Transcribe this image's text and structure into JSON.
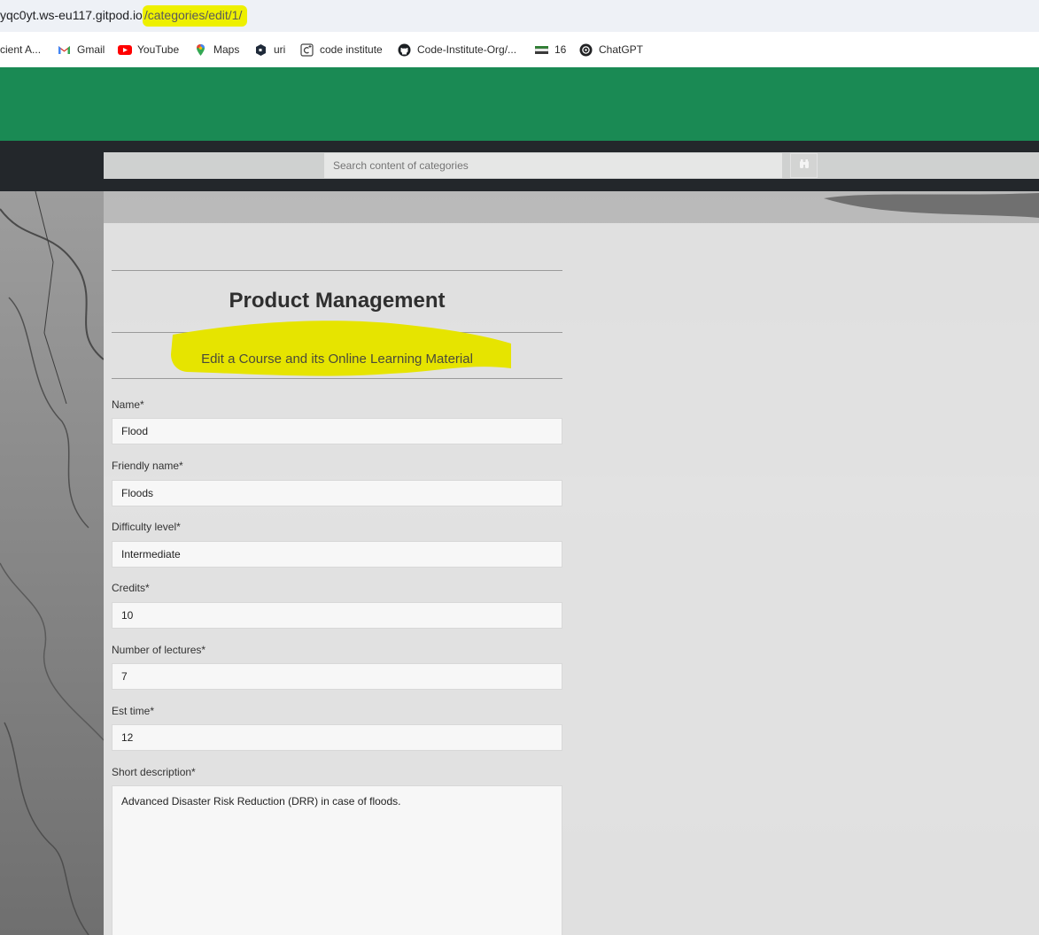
{
  "browser": {
    "url_prefix": "yqc0yt.ws-eu117.gitpod.io",
    "url_path": "/categories/edit/1/",
    "bookmarks": [
      {
        "label": "cient A...",
        "icon": "none"
      },
      {
        "label": "Gmail",
        "icon": "gmail-icon"
      },
      {
        "label": "YouTube",
        "icon": "youtube-icon"
      },
      {
        "label": "Maps",
        "icon": "maps-icon"
      },
      {
        "label": "uri",
        "icon": "uri-icon"
      },
      {
        "label": "code institute",
        "icon": "code-institute-icon"
      },
      {
        "label": "Code-Institute-Org/...",
        "icon": "github-icon"
      },
      {
        "label": "16",
        "icon": "flag-icon"
      },
      {
        "label": "ChatGPT",
        "icon": "chatgpt-icon"
      }
    ]
  },
  "nav": {
    "search_placeholder": "Search content of categories",
    "search_button_icon": "binoculars-icon"
  },
  "page": {
    "title": "Product Management",
    "subtitle": "Edit a Course and its Online Learning Material"
  },
  "form": {
    "name": {
      "label": "Name*",
      "value": "Flood"
    },
    "friendly_name": {
      "label": "Friendly name*",
      "value": "Floods"
    },
    "difficulty": {
      "label": "Difficulty level*",
      "value": "Intermediate"
    },
    "credits": {
      "label": "Credits*",
      "value": "10"
    },
    "lectures": {
      "label": "Number of lectures*",
      "value": "7"
    },
    "est_time": {
      "label": "Est time*",
      "value": "12"
    },
    "short_description": {
      "label": "Short description*",
      "value": "Advanced Disaster Risk Reduction (DRR) in case of floods."
    }
  },
  "colors": {
    "highlight": "#eef000",
    "brand_green": "#1a8a54",
    "nav_dark": "#23272b"
  }
}
